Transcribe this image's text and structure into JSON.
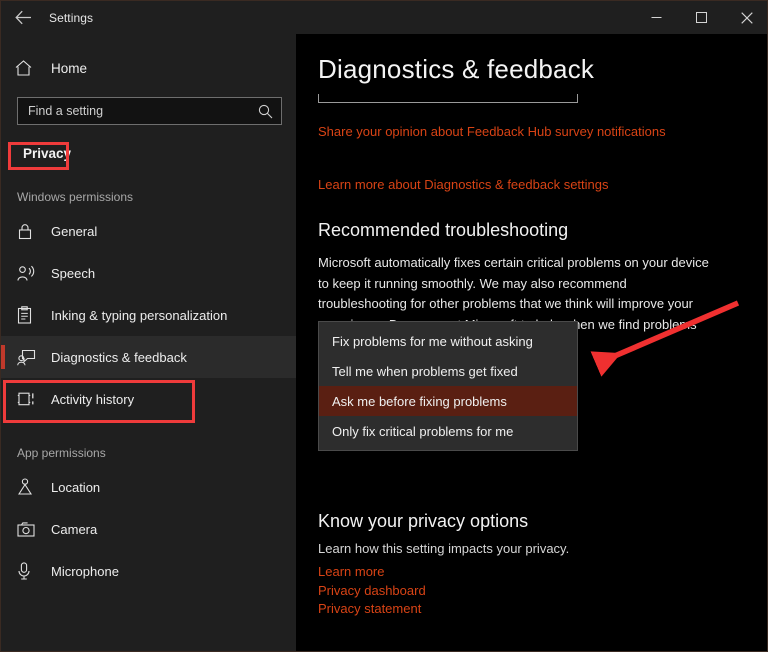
{
  "window": {
    "title": "Settings",
    "back_icon": "back-arrow-icon",
    "minimize_label": "–",
    "maximize_label": "□",
    "close_label": "✕"
  },
  "sidebar": {
    "home": {
      "label": "Home",
      "icon": "home-icon"
    },
    "search": {
      "placeholder": "Find a setting",
      "value": "",
      "icon": "search-icon"
    },
    "category": "Privacy",
    "groups": [
      {
        "label": "Windows permissions",
        "items": [
          {
            "label": "General",
            "icon": "lock-icon",
            "selected": false
          },
          {
            "label": "Speech",
            "icon": "speech-person-icon",
            "selected": false
          },
          {
            "label": "Inking & typing personalization",
            "icon": "clipboard-icon",
            "selected": false
          },
          {
            "label": "Diagnostics & feedback",
            "icon": "feedback-person-icon",
            "selected": true
          },
          {
            "label": "Activity history",
            "icon": "activity-history-icon",
            "selected": false
          }
        ]
      },
      {
        "label": "App permissions",
        "items": [
          {
            "label": "Location",
            "icon": "location-pin-icon",
            "selected": false
          },
          {
            "label": "Camera",
            "icon": "camera-icon",
            "selected": false
          },
          {
            "label": "Microphone",
            "icon": "microphone-icon",
            "selected": false
          }
        ]
      }
    ]
  },
  "main": {
    "page_title": "Diagnostics & feedback",
    "link_survey": "Share your opinion about Feedback Hub survey notifications",
    "link_learn_settings": "Learn more about Diagnostics & feedback settings",
    "troubleshooting": {
      "heading": "Recommended troubleshooting",
      "description": "Microsoft automatically fixes certain critical problems on your device to keep it running smoothly. We may also recommend troubleshooting for other problems that we think will improve your experience. Do you want Microsoft to help when we find problems that you may not be able to fix?",
      "dropdown": {
        "options": [
          "Fix problems for me without asking",
          "Tell me when problems get fixed",
          "Ask me before fixing problems",
          "Only fix critical problems for me"
        ],
        "selected": "Ask me before fixing problems"
      }
    },
    "privacy": {
      "heading": "Know your privacy options",
      "subtitle": "Learn how this setting impacts your privacy.",
      "links": [
        "Learn more",
        "Privacy dashboard",
        "Privacy statement"
      ]
    }
  },
  "annotations": {
    "highlight_boxes": [
      "Privacy",
      "Diagnostics & feedback"
    ],
    "arrow_color": "#f03030",
    "highlight_color": "#ef3b3b"
  },
  "colors": {
    "accent_link": "#d84315",
    "dropdown_selected_bg": "#5a1f12",
    "sidebar_bg": "#1f1f1f",
    "main_bg": "#000000"
  }
}
